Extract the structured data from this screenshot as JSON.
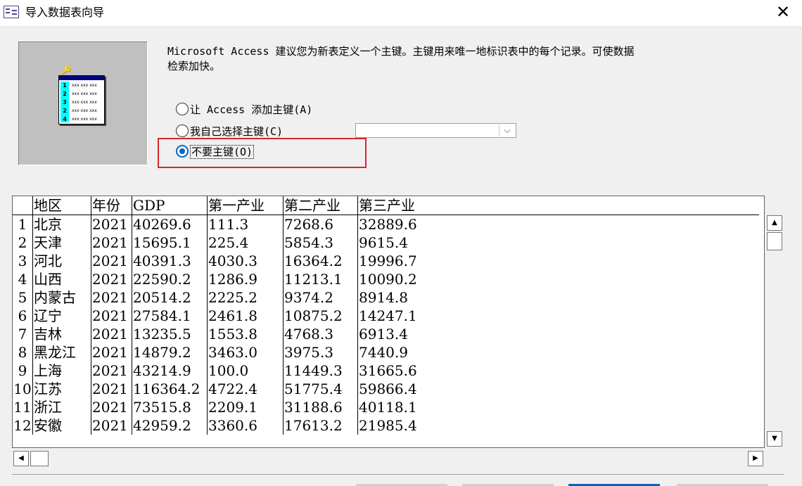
{
  "window": {
    "title": "导入数据表向导"
  },
  "description": "Microsoft Access 建议您为新表定义一个主键。主键用来唯一地标识表中的每个记录。可使数据检索加快。",
  "description_line1": "Microsoft Access 建议您为新表定义一个主键。主键用来唯一地标识表中的每个记录。可使数据",
  "description_line2": "检索加快。",
  "options": [
    {
      "label": "让 Access 添加主键(A)",
      "selected": false
    },
    {
      "label": "我自己选择主键(C)",
      "selected": false
    },
    {
      "label": "不要主键(O)",
      "selected": true
    }
  ],
  "key_field_select": {
    "value": ""
  },
  "preview": {
    "columns": [
      "地区",
      "年份",
      "GDP",
      "第一产业",
      "第二产业",
      "第三产业"
    ],
    "rows": [
      [
        "1",
        "北京",
        "2021",
        "40269.6",
        "111.3",
        "7268.6",
        "32889.6"
      ],
      [
        "2",
        "天津",
        "2021",
        "15695.1",
        "225.4",
        "5854.3",
        "9615.4"
      ],
      [
        "3",
        "河北",
        "2021",
        "40391.3",
        "4030.3",
        "16364.2",
        "19996.7"
      ],
      [
        "4",
        "山西",
        "2021",
        "22590.2",
        "1286.9",
        "11213.1",
        "10090.2"
      ],
      [
        "5",
        "内蒙古",
        "2021",
        "20514.2",
        "2225.2",
        "9374.2",
        "8914.8"
      ],
      [
        "6",
        "辽宁",
        "2021",
        "27584.1",
        "2461.8",
        "10875.2",
        "14247.1"
      ],
      [
        "7",
        "吉林",
        "2021",
        "13235.5",
        "1553.8",
        "4768.3",
        "6913.4"
      ],
      [
        "8",
        "黑龙江",
        "2021",
        "14879.2",
        "3463.0",
        "3975.3",
        "7440.9"
      ],
      [
        "9",
        "上海",
        "2021",
        "43214.9",
        "100.0",
        "11449.3",
        "31665.6"
      ],
      [
        "10",
        "江苏",
        "2021",
        "116364.2",
        "4722.4",
        "51775.4",
        "59866.4"
      ],
      [
        "11",
        "浙江",
        "2021",
        "73515.8",
        "2209.1",
        "31188.6",
        "40118.1"
      ],
      [
        "12",
        "安徽",
        "2021",
        "42959.2",
        "3360.6",
        "17613.2",
        "21985.4"
      ]
    ]
  },
  "illustration": {
    "numbers": [
      "1",
      "2",
      "3",
      "2",
      "4"
    ],
    "cell_text": "xxx xxx xxx"
  },
  "colors": {
    "accent": "#0067c0",
    "highlight_border": "#d7262e"
  }
}
